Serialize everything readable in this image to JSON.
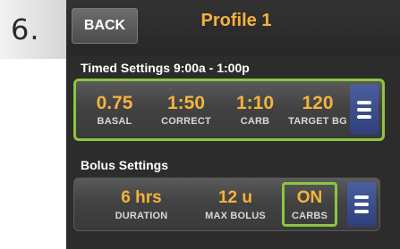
{
  "step_number": "6.",
  "header": {
    "back_label": "BACK",
    "title": "Profile 1"
  },
  "timed_settings": {
    "label": "Timed Settings 9:00a - 1:00p",
    "items": [
      {
        "value": "0.75",
        "label": "BASAL"
      },
      {
        "value": "1:50",
        "label": "CORRECT"
      },
      {
        "value": "1:10",
        "label": "CARB"
      },
      {
        "value": "120",
        "label": "TARGET BG"
      }
    ],
    "highlighted": true
  },
  "bolus_settings": {
    "label": "Bolus Settings",
    "items": [
      {
        "value": "6 hrs",
        "label": "DURATION"
      },
      {
        "value": "12 u",
        "label": "MAX BOLUS"
      },
      {
        "value": "ON",
        "label": "CARBS"
      }
    ],
    "highlighted_item": "CARBS"
  },
  "colors": {
    "accent_orange": "#f3b33d",
    "highlight_green": "#8dc63f",
    "menu_blue": "#3a4f8f"
  },
  "icons": [
    "menu-icon"
  ]
}
